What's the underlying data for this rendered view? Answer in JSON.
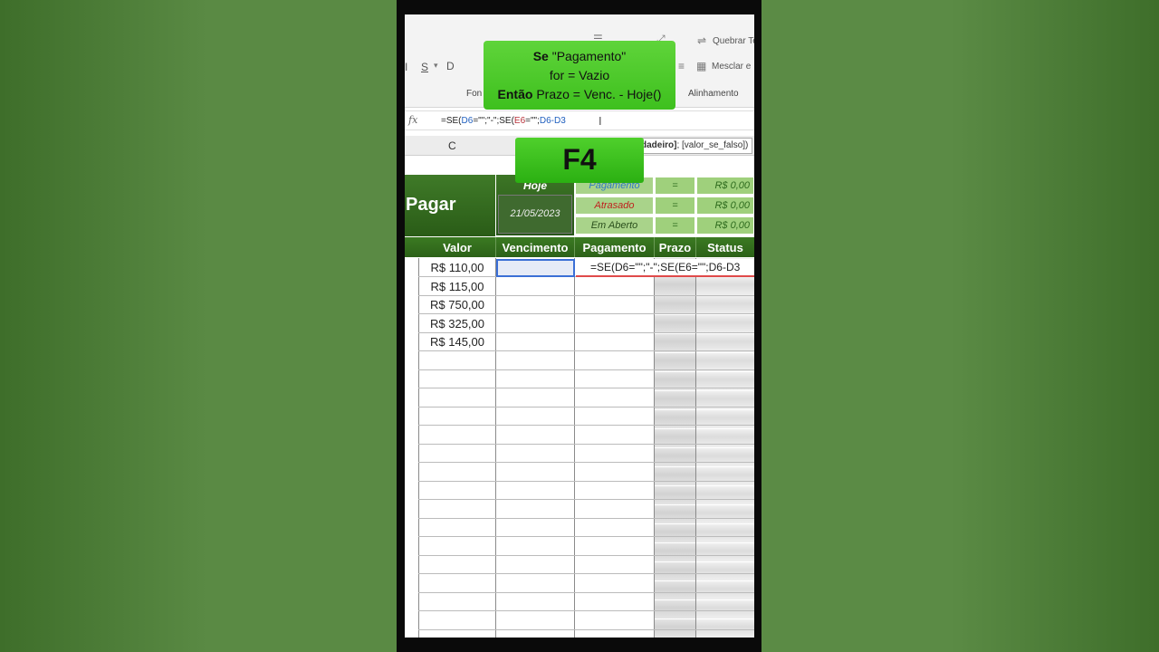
{
  "ribbon": {
    "wrap_text": "Quebrar Tex",
    "merge_center": "Mesclar e",
    "font_group": "Fon",
    "alignment_group": "Alinhamento",
    "italic": "I",
    "underline": "S",
    "bold_partial": "D"
  },
  "formula_bar": {
    "fx": "fx",
    "p1": "=SE(",
    "p2": "D6",
    "p3": "=\"\";\"-\";SE(",
    "p4": "E6",
    "p5": "=\"\";",
    "p6": "D6-D3",
    "tooltip_bold": "dadeiro]",
    "tooltip_rest": "; [valor_se_falso])"
  },
  "column_header": {
    "c": "C"
  },
  "sheet": {
    "title": "Pagar",
    "hoje_label": "Hoje",
    "hoje_date": "21/05/2023",
    "summary": [
      {
        "label": "Pagamento",
        "eq": "=",
        "value": "R$ 0,00",
        "color": "#2f78c4"
      },
      {
        "label": "Atrasado",
        "eq": "=",
        "value": "R$ 0,00",
        "color": "#c0201e"
      },
      {
        "label": "Em Aberto",
        "eq": "=",
        "value": "R$ 0,00",
        "color": "#2a4f1c"
      }
    ],
    "headers": {
      "valor": "Valor",
      "vencimento": "Vencimento",
      "pagamento": "Pagamento",
      "prazo": "Prazo",
      "status": "Status"
    },
    "values": [
      "R$ 110,00",
      "R$ 115,00",
      "R$ 750,00",
      "R$ 325,00",
      "R$ 145,00"
    ],
    "editing_formula": "=SE(D6=\"\";\"-\";SE(E6=\"\";D6-D3"
  },
  "overlays": {
    "line1_bold": "Se",
    "line1_rest": " \"Pagamento\"",
    "line2": "for = Vazio",
    "line3_bold": "Então",
    "line3_rest": " Prazo = Venc. - Hoje()",
    "key": "F4"
  }
}
